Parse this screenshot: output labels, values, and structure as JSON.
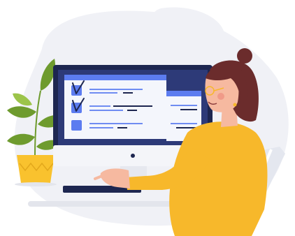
{
  "illustration": {
    "colors": {
      "background_blob": "#F0F1F6",
      "desk": "#E3E5EC",
      "monitor_bezel": "#1D2650",
      "screen_bg": "#2D3A78",
      "window_light": "#F4F6FC",
      "window_bar": "#5C7CF0",
      "check_box": "#5C7CF0",
      "text_line_dark": "#1D2650",
      "text_line_blue": "#6F8CF2",
      "monitor_stand": "#E6E8EF",
      "keyboard": "#1D2650",
      "pot": "#F9C22E",
      "leaf": "#6E9B2E",
      "leaf_light": "#9CC44A",
      "sweater": "#F7B82B",
      "skin": "#F6B9A0",
      "hair": "#6B2C2C",
      "chair": "#E4E7EF"
    },
    "icons": [
      "checkbox-checked-icon",
      "checkbox-checked-icon",
      "checkbox-empty-icon"
    ]
  }
}
